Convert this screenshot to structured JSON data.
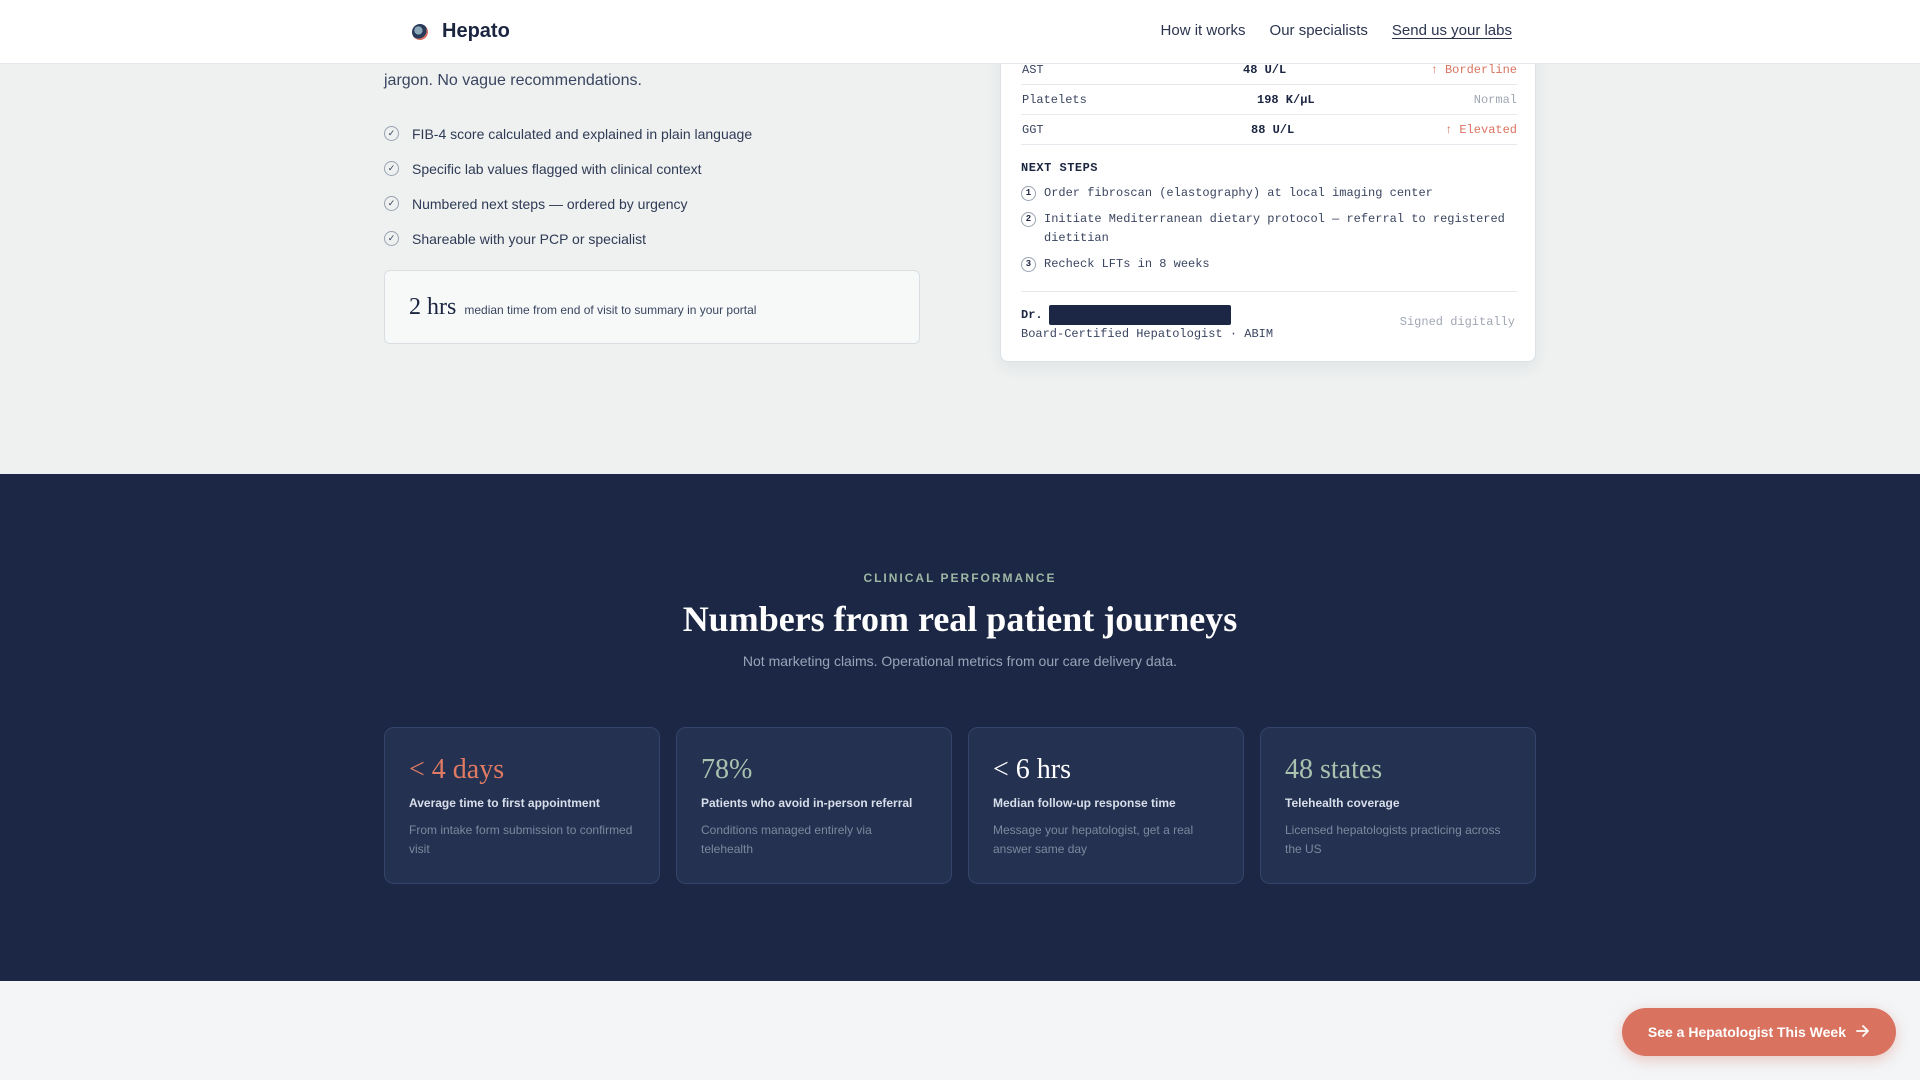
{
  "brand": {
    "name": "Hepato"
  },
  "nav": [
    {
      "label": "How it works"
    },
    {
      "label": "Our specialists"
    },
    {
      "label": "Send us your labs"
    }
  ],
  "intro": {
    "tail": "jargon. No vague recommendations.",
    "checklist": [
      "FIB-4 score calculated and explained in plain language",
      "Specific lab values flagged with clinical context",
      "Numbered next steps — ordered by urgency",
      "Shareable with your PCP or specialist"
    ],
    "stat_value": "2 hrs",
    "stat_label": "median time from end of visit to summary in your portal"
  },
  "report": {
    "labs": [
      {
        "name": "AST",
        "value": "48 U/L",
        "flag": "↑ Borderline",
        "status": "warn"
      },
      {
        "name": "Platelets",
        "value": "198 K/μL",
        "flag": "Normal",
        "status": "normal"
      },
      {
        "name": "GGT",
        "value": "88 U/L",
        "flag": "↑ Elevated",
        "status": "warn"
      }
    ],
    "next_steps_title": "NEXT STEPS",
    "steps": [
      {
        "num": "1",
        "text": "Order fibroscan (elastography) at local imaging center"
      },
      {
        "num": "2",
        "text": "Initiate Mediterranean dietary protocol — referral to registered dietitian"
      },
      {
        "num": "3",
        "text": "Recheck LFTs in 8 weeks"
      }
    ],
    "doctor_prefix": "Dr.",
    "doctor_title": "Board-Certified Hepatologist · ABIM",
    "signed": "Signed digitally"
  },
  "performance": {
    "eyebrow": "CLINICAL PERFORMANCE",
    "title": "Numbers from real patient journeys",
    "subtitle": "Not marketing claims. Operational metrics from our care delivery data.",
    "metrics": [
      {
        "value": "< 4 days",
        "label": "Average time to first appointment",
        "desc": "From intake form submission to confirmed visit",
        "color": "#e07a63"
      },
      {
        "value": "78%",
        "label": "Patients who avoid in-person referral",
        "desc": "Conditions managed entirely via telehealth",
        "color": "#a9c2b0"
      },
      {
        "value": "< 6 hrs",
        "label": "Median follow-up response time",
        "desc": "Message your hepatologist, get a real answer same day",
        "color": "#ffffff"
      },
      {
        "value": "48 states",
        "label": "Telehealth coverage",
        "desc": "Licensed hepatologists practicing across the US",
        "color": "#a9c2b0"
      }
    ]
  },
  "cta": {
    "label": "See a Hepatologist This Week",
    "icon": "arrow-right-icon"
  },
  "colors": {
    "accent": "#d9735f",
    "navy": "#1b2744",
    "sage": "#9fb7a5"
  }
}
